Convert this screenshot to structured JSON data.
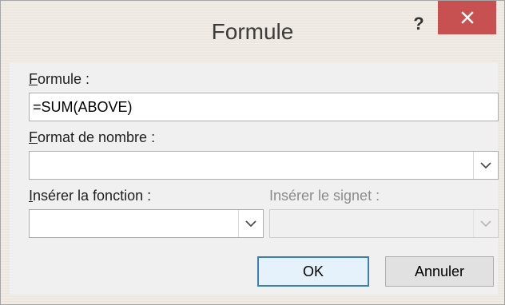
{
  "dialog": {
    "title": "Formule",
    "help_label": "?",
    "close_icon": "close-icon"
  },
  "formula": {
    "label_accel": "F",
    "label_rest": "ormule :",
    "value": "=SUM(ABOVE)"
  },
  "number_format": {
    "label_accel": "F",
    "label_rest": "ormat de nombre :",
    "value": ""
  },
  "insert_function": {
    "label_accel": "I",
    "label_rest": "nsérer la fonction :",
    "value": ""
  },
  "insert_bookmark": {
    "label": "Insérer le signet :",
    "value": "",
    "enabled": false
  },
  "buttons": {
    "ok_label": "OK",
    "cancel_label": "Annuler"
  },
  "colors": {
    "close_button": "#c75050",
    "default_button_border": "#3c7fb1",
    "frame": "#efe9e0"
  }
}
